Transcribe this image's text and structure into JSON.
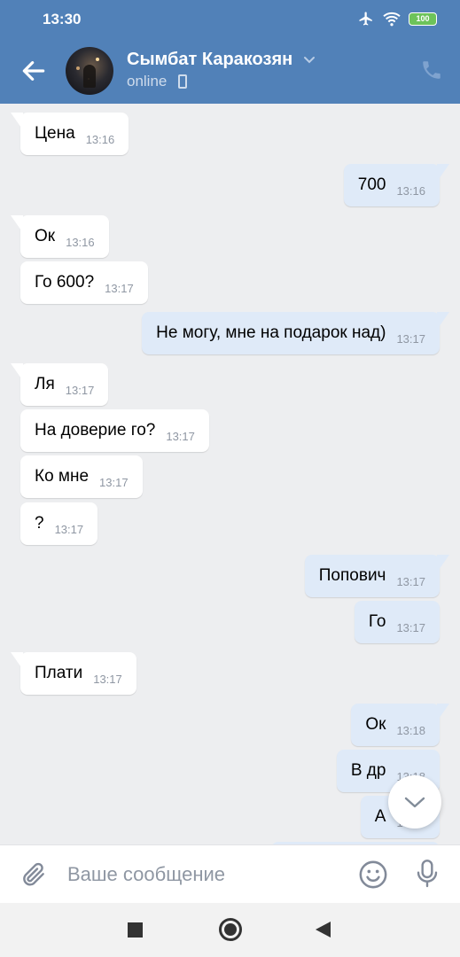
{
  "status_bar": {
    "time": "13:30",
    "battery": "100"
  },
  "header": {
    "contact_name": "Сымбат Каракозян",
    "status": "online"
  },
  "messages": [
    {
      "text": "Цена",
      "time": "13:16",
      "dir": "in"
    },
    {
      "text": "700",
      "time": "13:16",
      "dir": "out"
    },
    {
      "text": "Ок",
      "time": "13:16",
      "dir": "in"
    },
    {
      "text": "Го 600?",
      "time": "13:17",
      "dir": "in"
    },
    {
      "text": "Не могу, мне на подарок над)",
      "time": "13:17",
      "dir": "out"
    },
    {
      "text": "Ля",
      "time": "13:17",
      "dir": "in"
    },
    {
      "text": "На доверие го?",
      "time": "13:17",
      "dir": "in"
    },
    {
      "text": "Ко мне",
      "time": "13:17",
      "dir": "in"
    },
    {
      "text": "?",
      "time": "13:17",
      "dir": "in"
    },
    {
      "text": "Попович",
      "time": "13:17",
      "dir": "out"
    },
    {
      "text": "Го",
      "time": "13:17",
      "dir": "out"
    },
    {
      "text": "Плати",
      "time": "13:17",
      "dir": "in"
    },
    {
      "text": "Ок",
      "time": "13:18",
      "dir": "out"
    },
    {
      "text": "В др",
      "time": "13:18",
      "dir": "out"
    },
    {
      "text": "А",
      "time": "13:18",
      "dir": "out"
    }
  ],
  "composer": {
    "placeholder": "Ваше сообщение"
  },
  "colors": {
    "header_bg": "#5181b8",
    "bubble_in": "#ffffff",
    "bubble_out": "#dfeaf8",
    "chat_bg": "#edeef0"
  },
  "icons": [
    "back-arrow-icon",
    "chevron-down-icon",
    "phone-icon",
    "airplane-icon",
    "wifi-icon",
    "battery-icon",
    "paperclip-icon",
    "emoji-icon",
    "microphone-icon",
    "scroll-down-icon"
  ]
}
